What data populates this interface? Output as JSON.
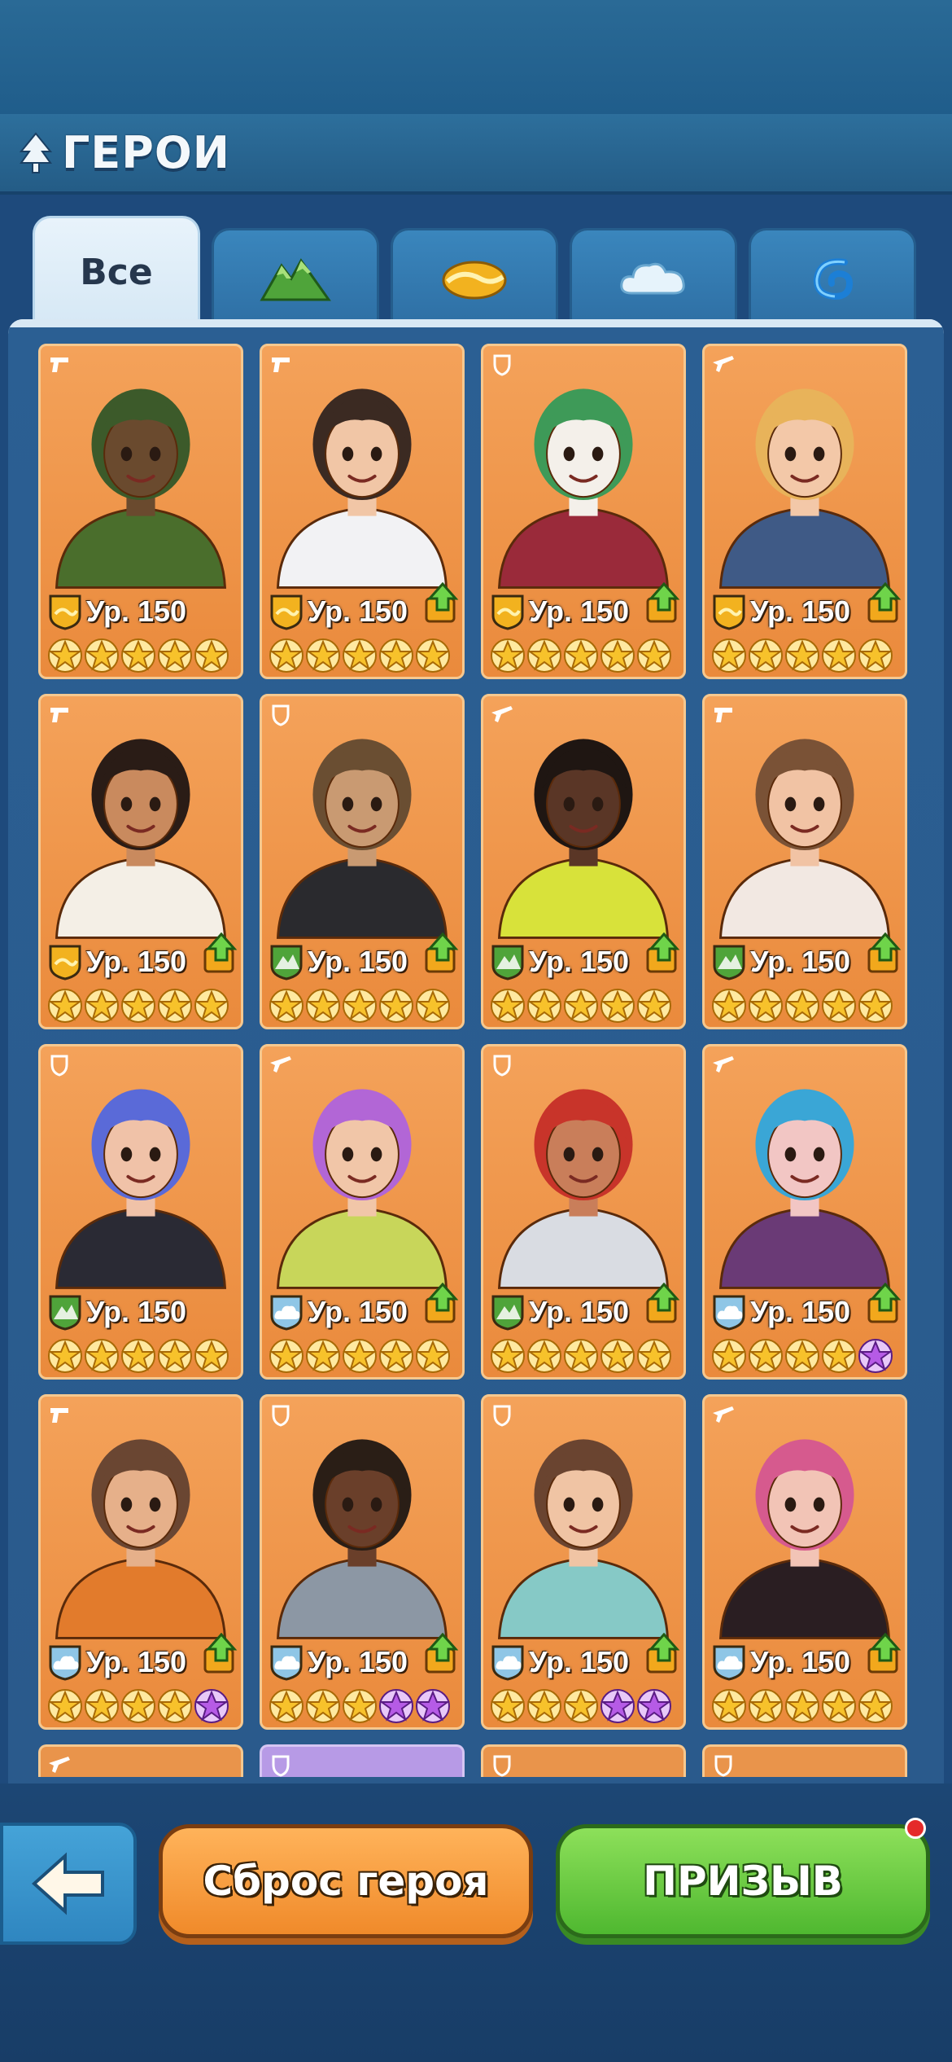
{
  "header": {
    "title": "ГЕРОИ",
    "icon": "tree-icon"
  },
  "tabs": [
    {
      "label": "Все",
      "icon": "",
      "active": true
    },
    {
      "label": "",
      "icon": "mountain-icon",
      "active": false
    },
    {
      "label": "",
      "icon": "desert-icon",
      "active": false
    },
    {
      "label": "",
      "icon": "cloud-icon",
      "active": false
    },
    {
      "label": "",
      "icon": "water-icon",
      "active": false
    }
  ],
  "colors": {
    "card": "#ea8a3c",
    "gold_star": "#f7c22b",
    "purple_star": "#b65be6",
    "mountain": "#4fa43a",
    "desert": "#f2b21f",
    "cloud": "#8fc6e6"
  },
  "heroes": [
    {
      "level": "Ур. 150",
      "element": "desert",
      "role": "gun",
      "upgrade": false,
      "stars": [
        "g",
        "g",
        "g",
        "g",
        "g"
      ],
      "skin": "#6a4a2e",
      "hair": "#3c5a2a",
      "outfit": "#4a6e2c"
    },
    {
      "level": "Ур. 150",
      "element": "desert",
      "role": "gun",
      "upgrade": true,
      "stars": [
        "g",
        "g",
        "g",
        "g",
        "g"
      ],
      "skin": "#f1c6a6",
      "hair": "#3b2a22",
      "outfit": "#f2f2f4"
    },
    {
      "level": "Ур. 150",
      "element": "desert",
      "role": "shield",
      "upgrade": true,
      "stars": [
        "g",
        "g",
        "g",
        "g",
        "g"
      ],
      "skin": "#f4f0ea",
      "hair": "#3e9a58",
      "outfit": "#9a2a3a"
    },
    {
      "level": "Ур. 150",
      "element": "desert",
      "role": "rifle",
      "upgrade": true,
      "stars": [
        "g",
        "g",
        "g",
        "g",
        "g"
      ],
      "skin": "#f3c8a8",
      "hair": "#e8b35a",
      "outfit": "#3f5a86"
    },
    {
      "level": "Ур. 150",
      "element": "desert",
      "role": "gun",
      "upgrade": true,
      "stars": [
        "g",
        "g",
        "g",
        "g",
        "g"
      ],
      "skin": "#c98a5e",
      "hair": "#2a1c16",
      "outfit": "#f4efe6"
    },
    {
      "level": "Ур. 150",
      "element": "mountain",
      "role": "shield",
      "upgrade": true,
      "stars": [
        "g",
        "g",
        "g",
        "g",
        "g"
      ],
      "skin": "#c99a72",
      "hair": "#6a4e32",
      "outfit": "#2a2a2e"
    },
    {
      "level": "Ур. 150",
      "element": "mountain",
      "role": "rifle",
      "upgrade": true,
      "stars": [
        "g",
        "g",
        "g",
        "g",
        "g"
      ],
      "skin": "#5a3626",
      "hair": "#1f1612",
      "outfit": "#d8e23a"
    },
    {
      "level": "Ур. 150",
      "element": "mountain",
      "role": "gun",
      "upgrade": true,
      "stars": [
        "g",
        "g",
        "g",
        "g",
        "g"
      ],
      "skin": "#f1c3a4",
      "hair": "#7a5236",
      "outfit": "#f2e8e2"
    },
    {
      "level": "Ур. 150",
      "element": "mountain",
      "role": "shield",
      "upgrade": false,
      "stars": [
        "g",
        "g",
        "g",
        "g",
        "g"
      ],
      "skin": "#f0c2a8",
      "hair": "#5a6ad8",
      "outfit": "#2a2a34"
    },
    {
      "level": "Ур. 150",
      "element": "cloud",
      "role": "rifle",
      "upgrade": true,
      "stars": [
        "g",
        "g",
        "g",
        "g",
        "g"
      ],
      "skin": "#f1c6a8",
      "hair": "#b266d6",
      "outfit": "#c8d65a"
    },
    {
      "level": "Ур. 150",
      "element": "mountain",
      "role": "shield",
      "upgrade": true,
      "stars": [
        "g",
        "g",
        "g",
        "g",
        "g"
      ],
      "skin": "#c97e5a",
      "hair": "#c8342a",
      "outfit": "#d9dce2"
    },
    {
      "level": "Ур. 150",
      "element": "cloud",
      "role": "rifle",
      "upgrade": true,
      "stars": [
        "g",
        "g",
        "g",
        "g",
        "p"
      ],
      "skin": "#f2c6c4",
      "hair": "#3aa6d6",
      "outfit": "#6a3a76"
    },
    {
      "level": "Ур. 150",
      "element": "cloud",
      "role": "gun",
      "upgrade": true,
      "stars": [
        "g",
        "g",
        "g",
        "g",
        "p"
      ],
      "skin": "#e6b08a",
      "hair": "#6a4632",
      "outfit": "#e27b2c"
    },
    {
      "level": "Ур. 150",
      "element": "cloud",
      "role": "shield",
      "upgrade": true,
      "stars": [
        "g",
        "g",
        "g",
        "p",
        "p"
      ],
      "skin": "#6a3f2a",
      "hair": "#2a1e16",
      "outfit": "#8c97a4"
    },
    {
      "level": "Ур. 150",
      "element": "cloud",
      "role": "shield",
      "upgrade": true,
      "stars": [
        "g",
        "g",
        "g",
        "p",
        "p"
      ],
      "skin": "#f0c4a4",
      "hair": "#6a4430",
      "outfit": "#86c9c6"
    },
    {
      "level": "Ур. 150",
      "element": "cloud",
      "role": "rifle",
      "upgrade": true,
      "stars": [
        "g",
        "g",
        "g",
        "g",
        "g"
      ],
      "skin": "#f2c4b6",
      "hair": "#d65a8e",
      "outfit": "#2a1e22"
    }
  ],
  "partial_cards": [
    {
      "role": "rifle",
      "purple": false
    },
    {
      "role": "shield",
      "purple": true
    },
    {
      "role": "shield",
      "purple": false
    },
    {
      "role": "shield",
      "purple": false
    }
  ],
  "footer": {
    "back_icon": "arrow-left-icon",
    "reset_label": "Сброс героя",
    "summon_label": "ПРИЗЫВ",
    "summon_notification": true
  }
}
